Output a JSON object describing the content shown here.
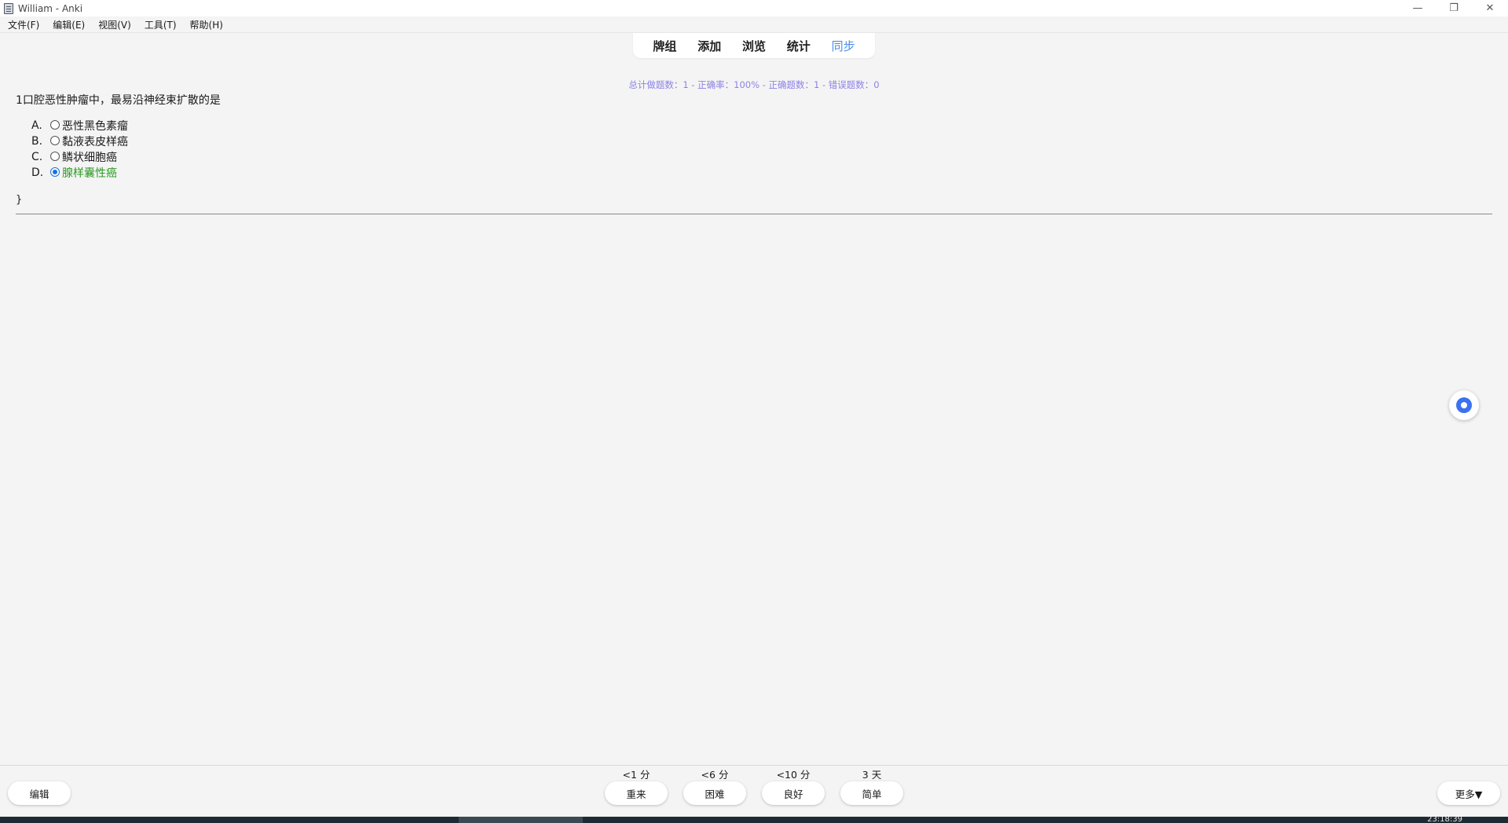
{
  "window": {
    "title": "William - Anki",
    "minimize": "—",
    "restore": "❐",
    "close": "✕"
  },
  "menu": [
    "文件(F)",
    "编辑(E)",
    "视图(V)",
    "工具(T)",
    "帮助(H)"
  ],
  "toolbar": {
    "decks": "牌组",
    "add": "添加",
    "browse": "浏览",
    "stats": "统计",
    "sync": "同步"
  },
  "stats_line": "总计做题数：1 - 正确率：100% - 正确题数：1 - 错误题数：0",
  "question": "1口腔恶性肿瘤中，最易沿神经束扩散的是",
  "options": [
    {
      "letter": "A.",
      "text": "恶性黑色素瘤",
      "selected": false,
      "correct": false
    },
    {
      "letter": "B.",
      "text": "黏液表皮样癌",
      "selected": false,
      "correct": false
    },
    {
      "letter": "C.",
      "text": "鳞状细胞癌",
      "selected": false,
      "correct": false
    },
    {
      "letter": "D.",
      "text": "腺样囊性癌",
      "selected": true,
      "correct": true
    }
  ],
  "brace": "}",
  "bottom": {
    "edit": "编辑",
    "more": "更多▼",
    "answers": [
      {
        "interval": "<1 分",
        "label": "重来"
      },
      {
        "interval": "<6 分",
        "label": "困难"
      },
      {
        "interval": "<10 分",
        "label": "良好"
      },
      {
        "interval": "3 天",
        "label": "简单"
      }
    ]
  },
  "taskbar": {
    "clock": "23:18:39"
  },
  "colors": {
    "accent": "#4a8de6",
    "stats": "#8b82e6",
    "correct": "#2a9a22",
    "background": "#f4f4f4"
  }
}
